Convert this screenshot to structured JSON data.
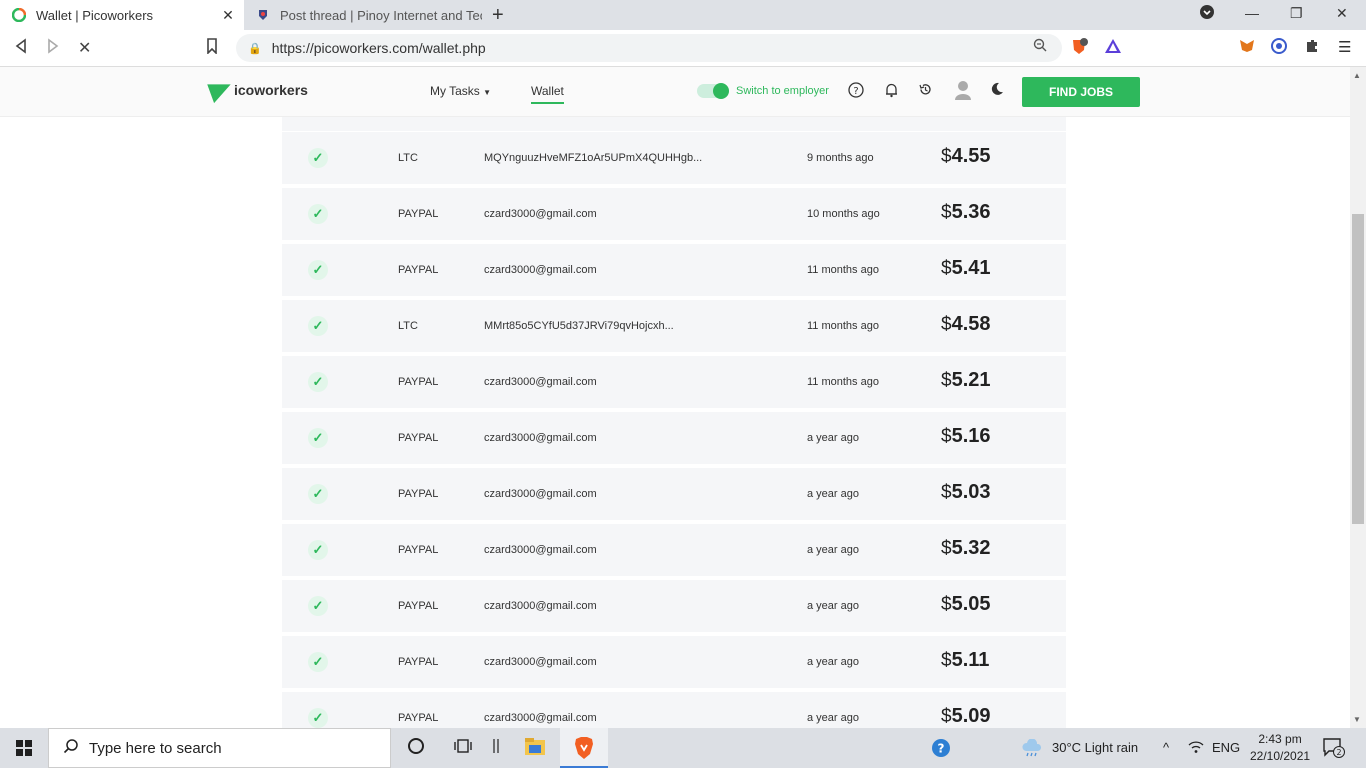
{
  "browser": {
    "tabs": [
      {
        "title": "Wallet | Picoworkers",
        "active": true
      },
      {
        "title": "Post thread | Pinoy Internet and Techn",
        "active": false
      }
    ],
    "url": "https://picoworkers.com/wallet.php",
    "brave_shield_count": "5"
  },
  "site": {
    "logo_text": "icoworkers",
    "nav": {
      "my_tasks": "My Tasks",
      "wallet": "Wallet"
    },
    "switch_label": "Switch to employer",
    "find_jobs": "FIND JOBS",
    "brand_color": "#2eb85c"
  },
  "transactions": [
    {
      "method": "LTC",
      "address": "MQYnguuzHveMFZ1oAr5UPmX4QUHHgb...",
      "time": "9 months ago",
      "currency": "$",
      "amount": "4.55"
    },
    {
      "method": "PAYPAL",
      "address": "czard3000@gmail.com",
      "time": "10 months ago",
      "currency": "$",
      "amount": "5.36"
    },
    {
      "method": "PAYPAL",
      "address": "czard3000@gmail.com",
      "time": "11 months ago",
      "currency": "$",
      "amount": "5.41"
    },
    {
      "method": "LTC",
      "address": "MMrt85o5CYfU5d37JRVi79qvHojcxh...",
      "time": "11 months ago",
      "currency": "$",
      "amount": "4.58"
    },
    {
      "method": "PAYPAL",
      "address": "czard3000@gmail.com",
      "time": "11 months ago",
      "currency": "$",
      "amount": "5.21"
    },
    {
      "method": "PAYPAL",
      "address": "czard3000@gmail.com",
      "time": "a year ago",
      "currency": "$",
      "amount": "5.16"
    },
    {
      "method": "PAYPAL",
      "address": "czard3000@gmail.com",
      "time": "a year ago",
      "currency": "$",
      "amount": "5.03"
    },
    {
      "method": "PAYPAL",
      "address": "czard3000@gmail.com",
      "time": "a year ago",
      "currency": "$",
      "amount": "5.32"
    },
    {
      "method": "PAYPAL",
      "address": "czard3000@gmail.com",
      "time": "a year ago",
      "currency": "$",
      "amount": "5.05"
    },
    {
      "method": "PAYPAL",
      "address": "czard3000@gmail.com",
      "time": "a year ago",
      "currency": "$",
      "amount": "5.11"
    },
    {
      "method": "PAYPAL",
      "address": "czard3000@gmail.com",
      "time": "a year ago",
      "currency": "$",
      "amount": "5.09"
    }
  ],
  "taskbar": {
    "search_placeholder": "Type here to search",
    "weather": "30°C  Light rain",
    "language": "ENG",
    "time": "2:43 pm",
    "date": "22/10/2021",
    "notification_count": "2"
  }
}
